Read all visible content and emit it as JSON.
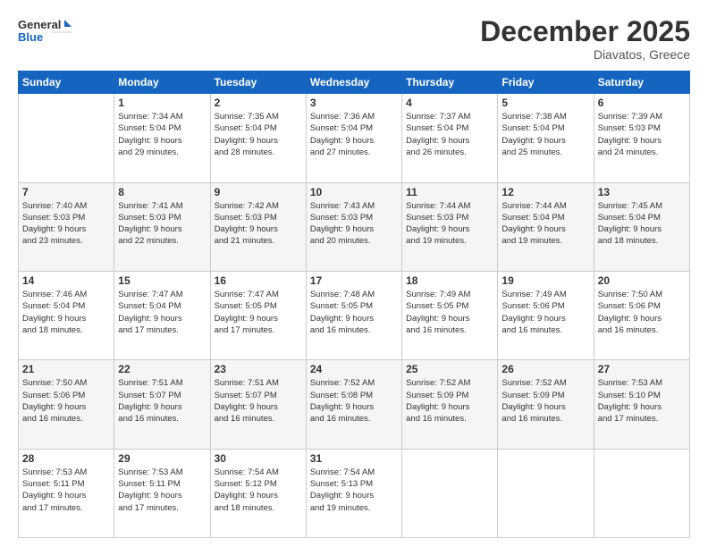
{
  "header": {
    "logo_line1": "General",
    "logo_line2": "Blue",
    "month_title": "December 2025",
    "location": "Diavatos, Greece"
  },
  "weekdays": [
    "Sunday",
    "Monday",
    "Tuesday",
    "Wednesday",
    "Thursday",
    "Friday",
    "Saturday"
  ],
  "weeks": [
    [
      {
        "day": "",
        "info": ""
      },
      {
        "day": "1",
        "info": "Sunrise: 7:34 AM\nSunset: 5:04 PM\nDaylight: 9 hours\nand 29 minutes."
      },
      {
        "day": "2",
        "info": "Sunrise: 7:35 AM\nSunset: 5:04 PM\nDaylight: 9 hours\nand 28 minutes."
      },
      {
        "day": "3",
        "info": "Sunrise: 7:36 AM\nSunset: 5:04 PM\nDaylight: 9 hours\nand 27 minutes."
      },
      {
        "day": "4",
        "info": "Sunrise: 7:37 AM\nSunset: 5:04 PM\nDaylight: 9 hours\nand 26 minutes."
      },
      {
        "day": "5",
        "info": "Sunrise: 7:38 AM\nSunset: 5:04 PM\nDaylight: 9 hours\nand 25 minutes."
      },
      {
        "day": "6",
        "info": "Sunrise: 7:39 AM\nSunset: 5:03 PM\nDaylight: 9 hours\nand 24 minutes."
      }
    ],
    [
      {
        "day": "7",
        "info": "Sunrise: 7:40 AM\nSunset: 5:03 PM\nDaylight: 9 hours\nand 23 minutes."
      },
      {
        "day": "8",
        "info": "Sunrise: 7:41 AM\nSunset: 5:03 PM\nDaylight: 9 hours\nand 22 minutes."
      },
      {
        "day": "9",
        "info": "Sunrise: 7:42 AM\nSunset: 5:03 PM\nDaylight: 9 hours\nand 21 minutes."
      },
      {
        "day": "10",
        "info": "Sunrise: 7:43 AM\nSunset: 5:03 PM\nDaylight: 9 hours\nand 20 minutes."
      },
      {
        "day": "11",
        "info": "Sunrise: 7:44 AM\nSunset: 5:03 PM\nDaylight: 9 hours\nand 19 minutes."
      },
      {
        "day": "12",
        "info": "Sunrise: 7:44 AM\nSunset: 5:04 PM\nDaylight: 9 hours\nand 19 minutes."
      },
      {
        "day": "13",
        "info": "Sunrise: 7:45 AM\nSunset: 5:04 PM\nDaylight: 9 hours\nand 18 minutes."
      }
    ],
    [
      {
        "day": "14",
        "info": "Sunrise: 7:46 AM\nSunset: 5:04 PM\nDaylight: 9 hours\nand 18 minutes."
      },
      {
        "day": "15",
        "info": "Sunrise: 7:47 AM\nSunset: 5:04 PM\nDaylight: 9 hours\nand 17 minutes."
      },
      {
        "day": "16",
        "info": "Sunrise: 7:47 AM\nSunset: 5:05 PM\nDaylight: 9 hours\nand 17 minutes."
      },
      {
        "day": "17",
        "info": "Sunrise: 7:48 AM\nSunset: 5:05 PM\nDaylight: 9 hours\nand 16 minutes."
      },
      {
        "day": "18",
        "info": "Sunrise: 7:49 AM\nSunset: 5:05 PM\nDaylight: 9 hours\nand 16 minutes."
      },
      {
        "day": "19",
        "info": "Sunrise: 7:49 AM\nSunset: 5:06 PM\nDaylight: 9 hours\nand 16 minutes."
      },
      {
        "day": "20",
        "info": "Sunrise: 7:50 AM\nSunset: 5:06 PM\nDaylight: 9 hours\nand 16 minutes."
      }
    ],
    [
      {
        "day": "21",
        "info": "Sunrise: 7:50 AM\nSunset: 5:06 PM\nDaylight: 9 hours\nand 16 minutes."
      },
      {
        "day": "22",
        "info": "Sunrise: 7:51 AM\nSunset: 5:07 PM\nDaylight: 9 hours\nand 16 minutes."
      },
      {
        "day": "23",
        "info": "Sunrise: 7:51 AM\nSunset: 5:07 PM\nDaylight: 9 hours\nand 16 minutes."
      },
      {
        "day": "24",
        "info": "Sunrise: 7:52 AM\nSunset: 5:08 PM\nDaylight: 9 hours\nand 16 minutes."
      },
      {
        "day": "25",
        "info": "Sunrise: 7:52 AM\nSunset: 5:09 PM\nDaylight: 9 hours\nand 16 minutes."
      },
      {
        "day": "26",
        "info": "Sunrise: 7:52 AM\nSunset: 5:09 PM\nDaylight: 9 hours\nand 16 minutes."
      },
      {
        "day": "27",
        "info": "Sunrise: 7:53 AM\nSunset: 5:10 PM\nDaylight: 9 hours\nand 17 minutes."
      }
    ],
    [
      {
        "day": "28",
        "info": "Sunrise: 7:53 AM\nSunset: 5:11 PM\nDaylight: 9 hours\nand 17 minutes."
      },
      {
        "day": "29",
        "info": "Sunrise: 7:53 AM\nSunset: 5:11 PM\nDaylight: 9 hours\nand 17 minutes."
      },
      {
        "day": "30",
        "info": "Sunrise: 7:54 AM\nSunset: 5:12 PM\nDaylight: 9 hours\nand 18 minutes."
      },
      {
        "day": "31",
        "info": "Sunrise: 7:54 AM\nSunset: 5:13 PM\nDaylight: 9 hours\nand 19 minutes."
      },
      {
        "day": "",
        "info": ""
      },
      {
        "day": "",
        "info": ""
      },
      {
        "day": "",
        "info": ""
      }
    ]
  ]
}
